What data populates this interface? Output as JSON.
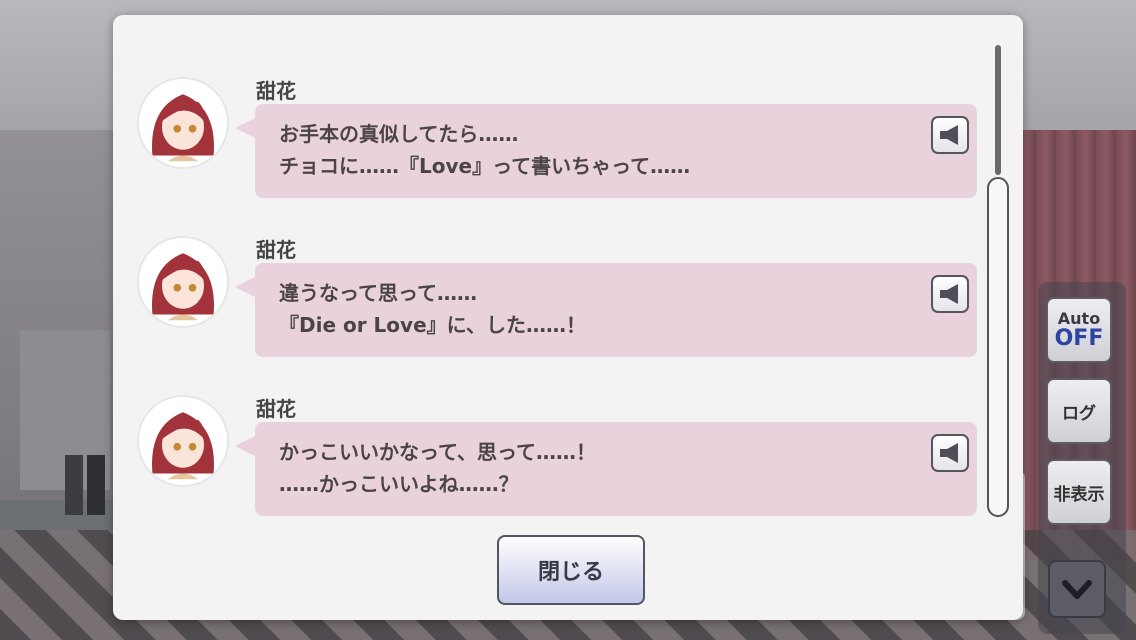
{
  "log": {
    "entries": [
      {
        "speaker": "甜花",
        "lines": [
          "お手本の真似してたら……",
          "チョコに……『Love』って書いちゃって……"
        ]
      },
      {
        "speaker": "甜花",
        "lines": [
          "違うなって思って……",
          "『Die or Love』に、した……！"
        ]
      },
      {
        "speaker": "甜花",
        "lines": [
          "かっこいいかなって、思って……！",
          "……かっこいいよね……？"
        ]
      }
    ],
    "close_label": "閉じる"
  },
  "side_menu": {
    "auto_label": "Auto",
    "auto_state": "OFF",
    "log_label": "ログ",
    "hide_label": "非表示"
  },
  "colors": {
    "bubble": "#ead2dc",
    "auto_off": "#2c45a3"
  }
}
